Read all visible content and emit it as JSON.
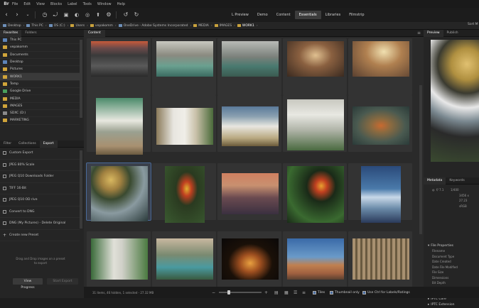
{
  "menubar": {
    "items": [
      "File",
      "Edit",
      "View",
      "Blocks",
      "Label",
      "Tools",
      "Window",
      "Help"
    ]
  },
  "workspaces": [
    "L Preview",
    "Demo",
    "Content",
    "Essentials",
    "Libraries",
    "Filmstrip"
  ],
  "breadcrumb": [
    "Desktop",
    "This PC",
    "OS (C:)",
    "Users",
    "vepakomm",
    "OneDrive - Adobe Systems Incorporated",
    "MEDIA",
    "IMAGES",
    "WORK1"
  ],
  "left_panel": {
    "top_tabs": [
      "Favorites",
      "Folders"
    ],
    "folders": [
      {
        "label": "This PC",
        "icon": "pc-icon"
      },
      {
        "label": "vepakomm",
        "icon": "folder-icon"
      },
      {
        "label": "Documents",
        "icon": "folder-icon"
      },
      {
        "label": "Desktop",
        "icon": "folder-icon"
      },
      {
        "label": "Pictures",
        "icon": "folder-icon"
      },
      {
        "label": "WORK1",
        "icon": "folder-icon"
      },
      {
        "label": "Temp",
        "icon": "folder-icon"
      },
      {
        "label": "Google Drive",
        "icon": "google-drive-icon"
      },
      {
        "label": "MEDIA",
        "icon": "folder-icon"
      },
      {
        "label": "IMAGES",
        "icon": "folder-icon"
      },
      {
        "label": "SDXC (D:)",
        "icon": "drive-icon"
      },
      {
        "label": "MARKETING",
        "icon": "folder-icon"
      }
    ],
    "bottom_tabs": [
      "Filter",
      "Collections",
      "Export"
    ],
    "export_items": [
      "Custom Export",
      "JPEG 80% Scale",
      "JPEG Q10 Downloads Folder",
      "TIFF 16-Bit",
      "JPEG Q10 OD rive",
      "Convert to DNG",
      "DNG (My Pictures) - Delete Original",
      "Create new Preset"
    ],
    "drop_hint": "Drag and Drop images on a preset to export",
    "view_progress_label": "View Progress",
    "start_export_label": "Start Export"
  },
  "content": {
    "tab_label": "Content",
    "status_text": "31 items, 46 hidden, 1 selected - 27.32 MB"
  },
  "right_panel": {
    "top_tabs": [
      "Preview",
      "Publish"
    ],
    "sort_label": "Sort M",
    "meta_tabs": [
      "Metadata",
      "Keywords"
    ],
    "summary": [
      {
        "label": "f/ 7.1",
        "value": "1/400"
      },
      {
        "label": "",
        "value": "3456 x"
      },
      {
        "label": "",
        "value": "27.23"
      },
      {
        "label": "",
        "value": "sRGB"
      }
    ],
    "file_properties_label": "File Properties",
    "file_properties": [
      "Filename",
      "Document Type",
      "Date Created",
      "Date File Modified",
      "File Size",
      "Dimensions",
      "Bit Depth",
      "Color Mode",
      "Color Profile"
    ],
    "iptc_core_label": "IPTC Core",
    "iptc_ext_label": "IPTC Extension"
  },
  "statusbar": {
    "tiles_label": "Tiles",
    "thumbnail_label": "Thumbnail only",
    "ctrl_label": "Use Ctrl for Labels/Ratings"
  }
}
